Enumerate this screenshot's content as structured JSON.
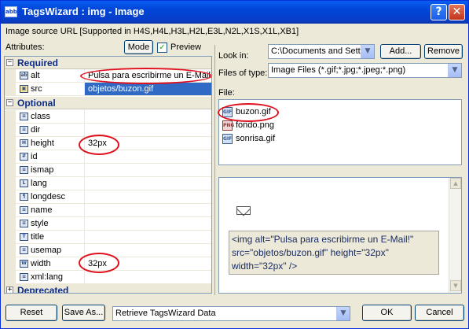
{
  "window": {
    "title": "TagsWizard : img - Image",
    "app_icon_text": "abba",
    "help_label": "?",
    "close_label": "✕"
  },
  "header": {
    "source_url": "Image source URL  [Supported in H4S,H4L,H3L,H2L,E3L,N2L,X1S,X1L,XB1]",
    "attributes_label": "Attributes:",
    "mode_button": "Mode",
    "preview_label": "Preview",
    "preview_checked": true
  },
  "grid": {
    "required_label": "Required",
    "optional_label": "Optional",
    "deprecated_label": "Deprecated",
    "required": [
      {
        "name": "alt",
        "value": "Pulsa para escribirme un E-Mail!"
      },
      {
        "name": "src",
        "value": "objetos/buzon.gif"
      }
    ],
    "optional": [
      {
        "name": "class",
        "value": ""
      },
      {
        "name": "dir",
        "value": ""
      },
      {
        "name": "height",
        "value": "32px"
      },
      {
        "name": "id",
        "value": ""
      },
      {
        "name": "ismap",
        "value": ""
      },
      {
        "name": "lang",
        "value": ""
      },
      {
        "name": "longdesc",
        "value": ""
      },
      {
        "name": "name",
        "value": ""
      },
      {
        "name": "style",
        "value": ""
      },
      {
        "name": "title",
        "value": ""
      },
      {
        "name": "usemap",
        "value": ""
      },
      {
        "name": "width",
        "value": "32px"
      },
      {
        "name": "xml:lang",
        "value": ""
      }
    ]
  },
  "browser": {
    "look_in_label": "Look in:",
    "look_in_value": "C:\\Documents and Setti",
    "add_button": "Add...",
    "remove_button": "Remove",
    "files_of_type_label": "Files of type:",
    "files_of_type_value": "Image Files (*.gif;*.jpg;*.jpeg;*.png)",
    "file_label": "File:",
    "files": [
      "buzon.gif",
      "fondo.png",
      "sonrisa.gif"
    ]
  },
  "preview": {
    "code": "<img alt=\"Pulsa para escribirme un E-Mail!\" src=\"objetos/buzon.gif\" height=\"32px\" width=\"32px\" />"
  },
  "footer": {
    "reset_button": "Reset",
    "save_as_button": "Save As...",
    "retrieve_value": "Retrieve TagsWizard Data",
    "ok_button": "OK",
    "cancel_button": "Cancel"
  },
  "colors": {
    "highlight_ring": "#e0101e",
    "title_bar": "#0045d8",
    "selection": "#316ac5"
  }
}
